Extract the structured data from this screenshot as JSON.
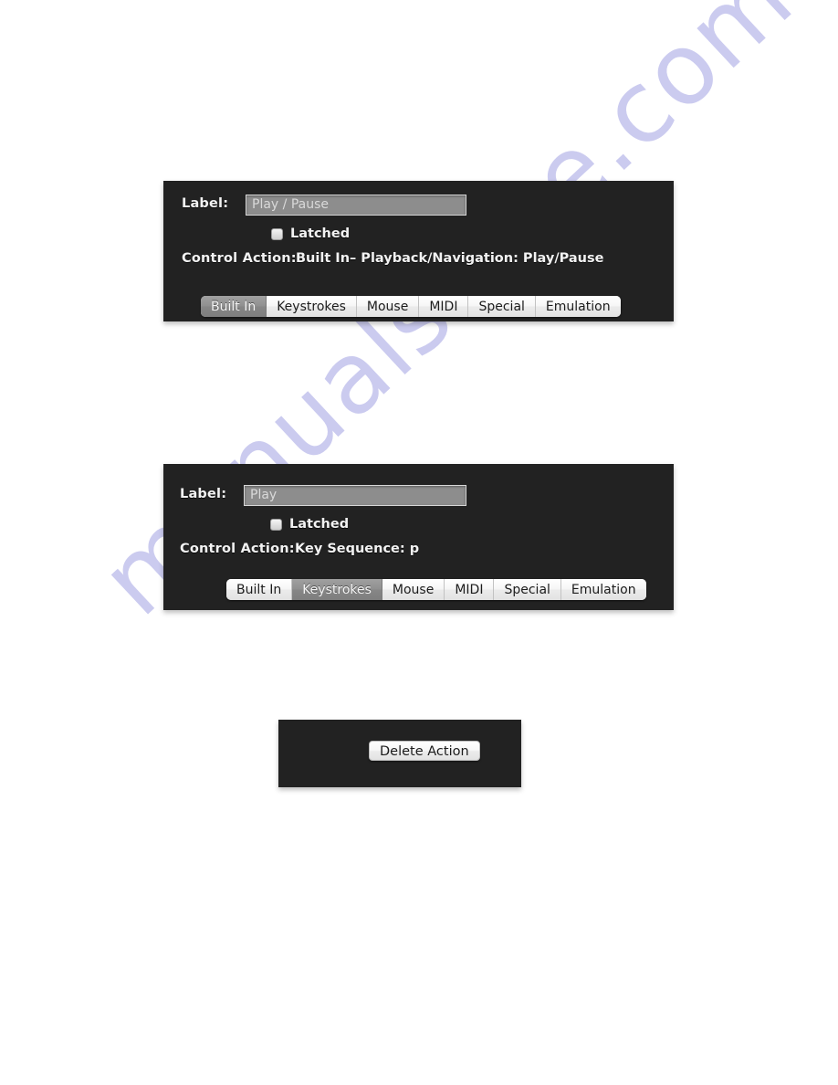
{
  "watermark": {
    "text": "manualshive.com",
    "color": "#c9c9ef"
  },
  "panels": [
    {
      "id": "playpause",
      "label_caption": "Label:",
      "label_value": "Play / Pause",
      "latched_label": "Latched",
      "latched_checked": false,
      "control_action_caption": "Control Action:",
      "control_action_value": "Built In– Playback/Navigation: Play/Pause",
      "tabs": [
        {
          "label": "Built In",
          "selected": true
        },
        {
          "label": "Keystrokes",
          "selected": false
        },
        {
          "label": "Mouse",
          "selected": false
        },
        {
          "label": "MIDI",
          "selected": false
        },
        {
          "label": "Special",
          "selected": false
        },
        {
          "label": "Emulation",
          "selected": false
        }
      ]
    },
    {
      "id": "play",
      "label_caption": "Label:",
      "label_value": "Play",
      "latched_label": "Latched",
      "latched_checked": false,
      "control_action_caption": "Control Action:",
      "control_action_value": "Key Sequence: p",
      "tabs": [
        {
          "label": "Built In",
          "selected": false
        },
        {
          "label": "Keystrokes",
          "selected": true
        },
        {
          "label": "Mouse",
          "selected": false
        },
        {
          "label": "MIDI",
          "selected": false
        },
        {
          "label": "Special",
          "selected": false
        },
        {
          "label": "Emulation",
          "selected": false
        }
      ]
    }
  ],
  "delete_panel": {
    "button_label": "Delete Action"
  }
}
